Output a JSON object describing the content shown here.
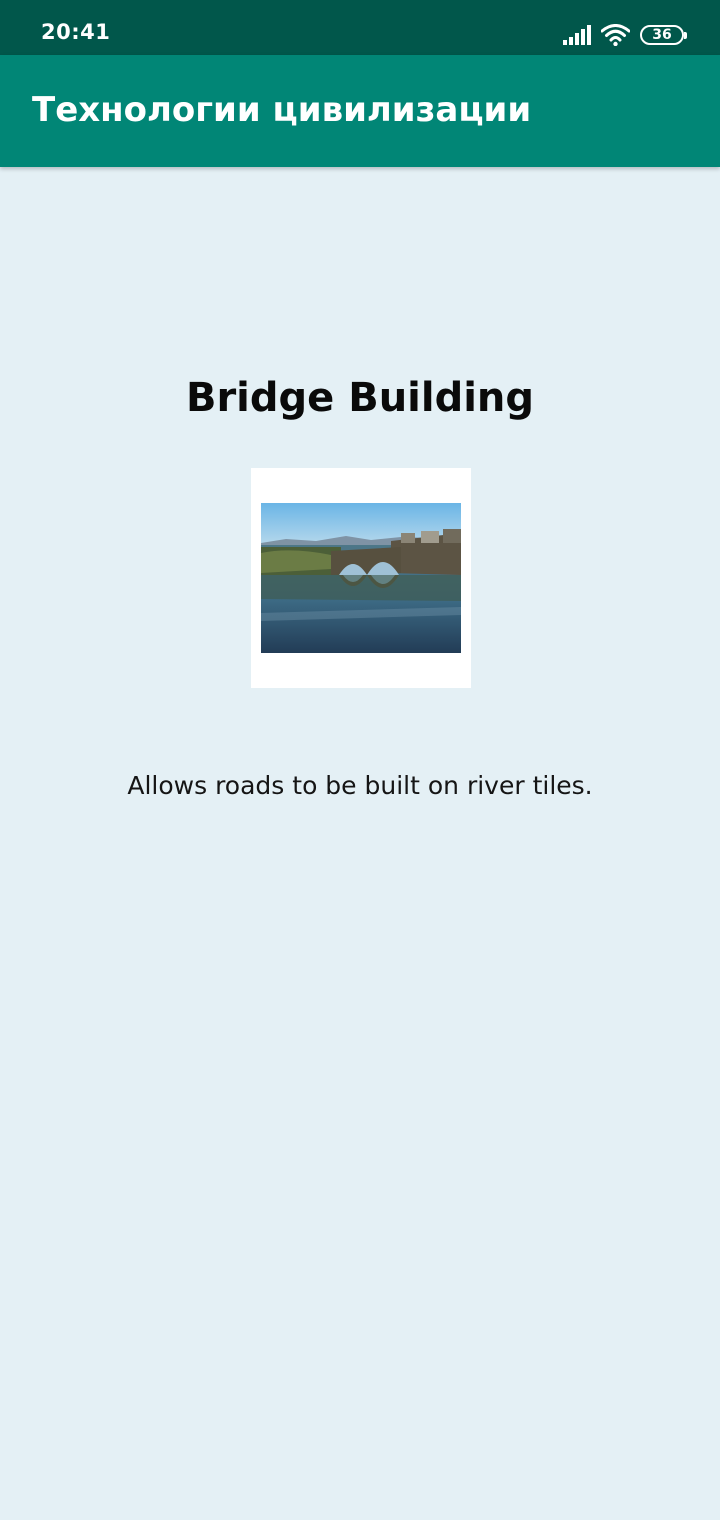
{
  "status_bar": {
    "time": "20:41",
    "battery_level": "36",
    "icons": [
      "signal-icon",
      "wifi-icon",
      "battery-icon"
    ]
  },
  "app_bar": {
    "title": "Технологии цивилизации"
  },
  "technology": {
    "name": "Bridge Building",
    "image_icon": "bridge-photo",
    "description": "Allows roads to be built on river tiles."
  },
  "colors": {
    "status_bar": "#01574b",
    "app_bar": "#018676",
    "background": "#e4f0f5",
    "text_primary": "#0a0a0a"
  }
}
